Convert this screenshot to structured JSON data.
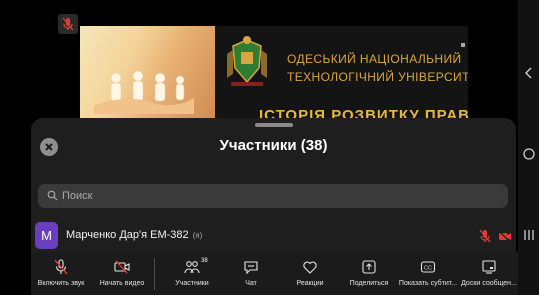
{
  "share": {
    "uni_line1": "ОДЕСЬКИЙ НАЦІОНАЛЬНИЙ",
    "uni_line2": "ТЕХНОЛОГІЧНИЙ УНІВЕРСИТЕТ",
    "title": "ІСТОРІЯ РОЗВИТКУ ПРАВ"
  },
  "panel": {
    "title": "Участники (38)",
    "search_placeholder": "Поиск",
    "participants": [
      {
        "initial": "M",
        "name": "Марченко Дар'я ЕМ-382",
        "tag": "(я)",
        "mic_muted": true,
        "video_off": true
      }
    ]
  },
  "toolbar": {
    "items": [
      {
        "id": "unmute",
        "label": "Включить звук",
        "icon": "mic-off-icon"
      },
      {
        "id": "video",
        "label": "Начать видео",
        "icon": "video-off-icon"
      },
      {
        "id": "participants",
        "label": "Участники",
        "icon": "participants-icon",
        "badge": "38"
      },
      {
        "id": "chat",
        "label": "Чат",
        "icon": "chat-icon"
      },
      {
        "id": "reactions",
        "label": "Реакции",
        "icon": "heart-icon"
      },
      {
        "id": "share",
        "label": "Поделиться",
        "icon": "share-icon"
      },
      {
        "id": "captions",
        "label": "Показать субтит...",
        "icon": "captions-icon"
      },
      {
        "id": "whiteboards",
        "label": "Доски сообщен...",
        "icon": "whiteboard-icon"
      }
    ]
  },
  "colors": {
    "accent_red": "#e53935",
    "avatar": "#6a3fbf",
    "panel_bg": "#1e1e1e",
    "title_gold": "#e7b743"
  }
}
